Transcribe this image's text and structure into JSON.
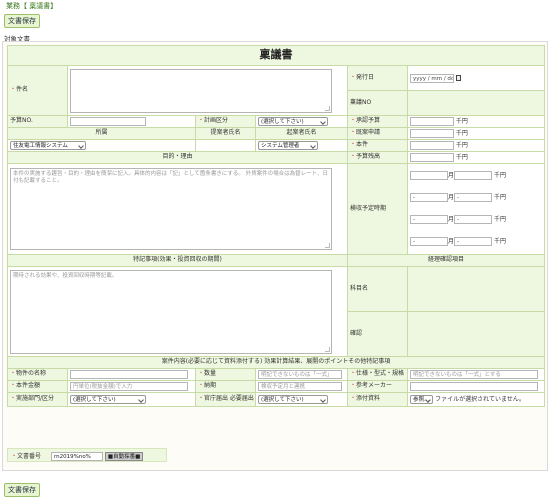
{
  "breadcrumb": "業務【 稟議書】",
  "save_label": "文書保存",
  "section_label": "対象文書",
  "form": {
    "title": "稟議書",
    "subject": {
      "label": "件名"
    },
    "issue_date": {
      "label": "発行日",
      "placeholder": "yyyy / mm / dd"
    },
    "ringi_no": {
      "label": "稟議NO"
    },
    "budget_no": {
      "label": "予算NO."
    },
    "plan_type": {
      "label": "計画区分",
      "value": "(選択して下さい)"
    },
    "approved_budget": {
      "label": "承認予算",
      "unit": "千円"
    },
    "applied_amount": {
      "label": "既案申請",
      "unit": "千円"
    },
    "this_case": {
      "label": "本件",
      "unit": "千円"
    },
    "budget_balance": {
      "label": "予算残高",
      "unit": "千円"
    },
    "dept": {
      "label": "所属",
      "value": "住友電工情報システム"
    },
    "proposer": {
      "label": "提案者氏名"
    },
    "drafter": {
      "label": "起案者氏名",
      "value": "システム管理者"
    },
    "purpose": {
      "label": "目的・理由",
      "placeholder": "本件の実施する趣旨・目的・理由を簡潔に記入。具体的内容は「記」として箇条書きにする。 外貨案件の場合は為替レート、日付も記載すること。"
    },
    "timing": {
      "label": "検収予定時期",
      "month_unit": "月",
      "unit": "千円",
      "dash": "-"
    },
    "notes": {
      "label": "特記事項(効果・投資回収の期間)",
      "placeholder": "期待される効果や、投資回収時期等記載。"
    },
    "check_items": {
      "label": "経理確認項目"
    },
    "account": {
      "label": "科目名"
    },
    "confirm": {
      "label": "確認"
    },
    "content_note": "案件内容(必要に応じて資料添付する) 効果計算結果、展開のポイントその他特記事項",
    "item_name": {
      "label": "物件の名称"
    },
    "quantity": {
      "label": "数量",
      "placeholder": "明記できないものは「一式」"
    },
    "spec": {
      "label": "仕様・型式・規格",
      "placeholder": "明記できないものは「一式」とする"
    },
    "amount": {
      "label": "本件金額",
      "placeholder": "円単位(税抜金額)で入力"
    },
    "delivery": {
      "label": "納期",
      "placeholder": "検収予定月と連携"
    },
    "maker": {
      "label": "参考メーカー"
    },
    "dept_division": {
      "label": "実施部門/区分",
      "value": "(選択して下さい)"
    },
    "gov_filing": {
      "label": "官庁届出 必要届出",
      "value": "(選択して下さい)"
    },
    "attachment": {
      "label": "添付資料",
      "button": "参照...",
      "status": "ファイルが選択されていません。"
    },
    "doc_number": {
      "label": "文書番号",
      "value": "rn2019%no%",
      "auto_tag": "■自動採番■"
    }
  }
}
